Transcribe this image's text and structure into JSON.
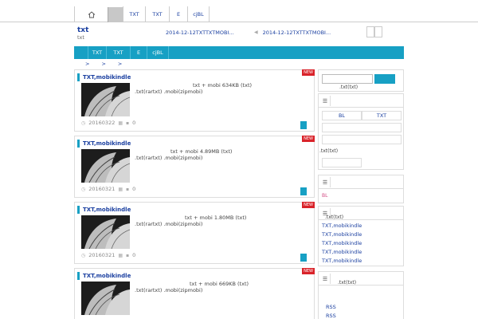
{
  "topnav": {
    "items": [
      "TXT",
      "TXT",
      "E",
      "cjBL"
    ]
  },
  "header": {
    "title": "txt",
    "subtitle": "txt",
    "link1": "2014-12-12TXTTXTMOBI...",
    "link2": "2014-12-12TXTTXTMOBI..."
  },
  "bluebar": {
    "items": [
      "TXT",
      "TXT",
      "E",
      "cjBL"
    ]
  },
  "breadcrumb": [
    ">",
    ">",
    ">"
  ],
  "posts": [
    {
      "title": "TXT,mobikindle",
      "badge": "NEW",
      "line1": "txt + mobi 634KB (txt)",
      "line2": ".txt(rartxt) .mobi(zipmobi)",
      "date": "20160322",
      "count": "0"
    },
    {
      "title": "TXT,mobikindle",
      "badge": "NEW",
      "line1": "txt + mobi 4.89MB (txt)",
      "line2": ".txt(rartxt) .mobi(zipmobi)",
      "date": "20160321",
      "count": "0"
    },
    {
      "title": "TXT,mobikindle",
      "badge": "NEW",
      "line1": "txt + mobi 1.80MB (txt)",
      "line2": ".txt(rartxt) .mobi(zipmobi)",
      "date": "20160321",
      "count": "0"
    },
    {
      "title": "TXT,mobikindle",
      "badge": "NEW",
      "line1": "txt + mobi 669KB (txt)",
      "line2": ".txt(rartxt) .mobi(zipmobi)"
    }
  ],
  "sidebar": {
    "search_caption": ".txt(txt)",
    "tabs": [
      "BL",
      "TXT"
    ],
    "tab_caption": ".txt(txt)",
    "red_link": "BL",
    "list_caption": ".txt(txt)",
    "list": [
      "TXT,mobikindle",
      "TXT,mobikindle",
      "TXT,mobikindle",
      "TXT,mobikindle",
      "TXT,mobikindle"
    ],
    "rss_caption": ".txt(txt)",
    "rss": [
      "RSS",
      "RSS"
    ]
  },
  "colors": {
    "accent": "#17a0c4",
    "link": "#1a3fa0",
    "badge": "#d9232a"
  }
}
